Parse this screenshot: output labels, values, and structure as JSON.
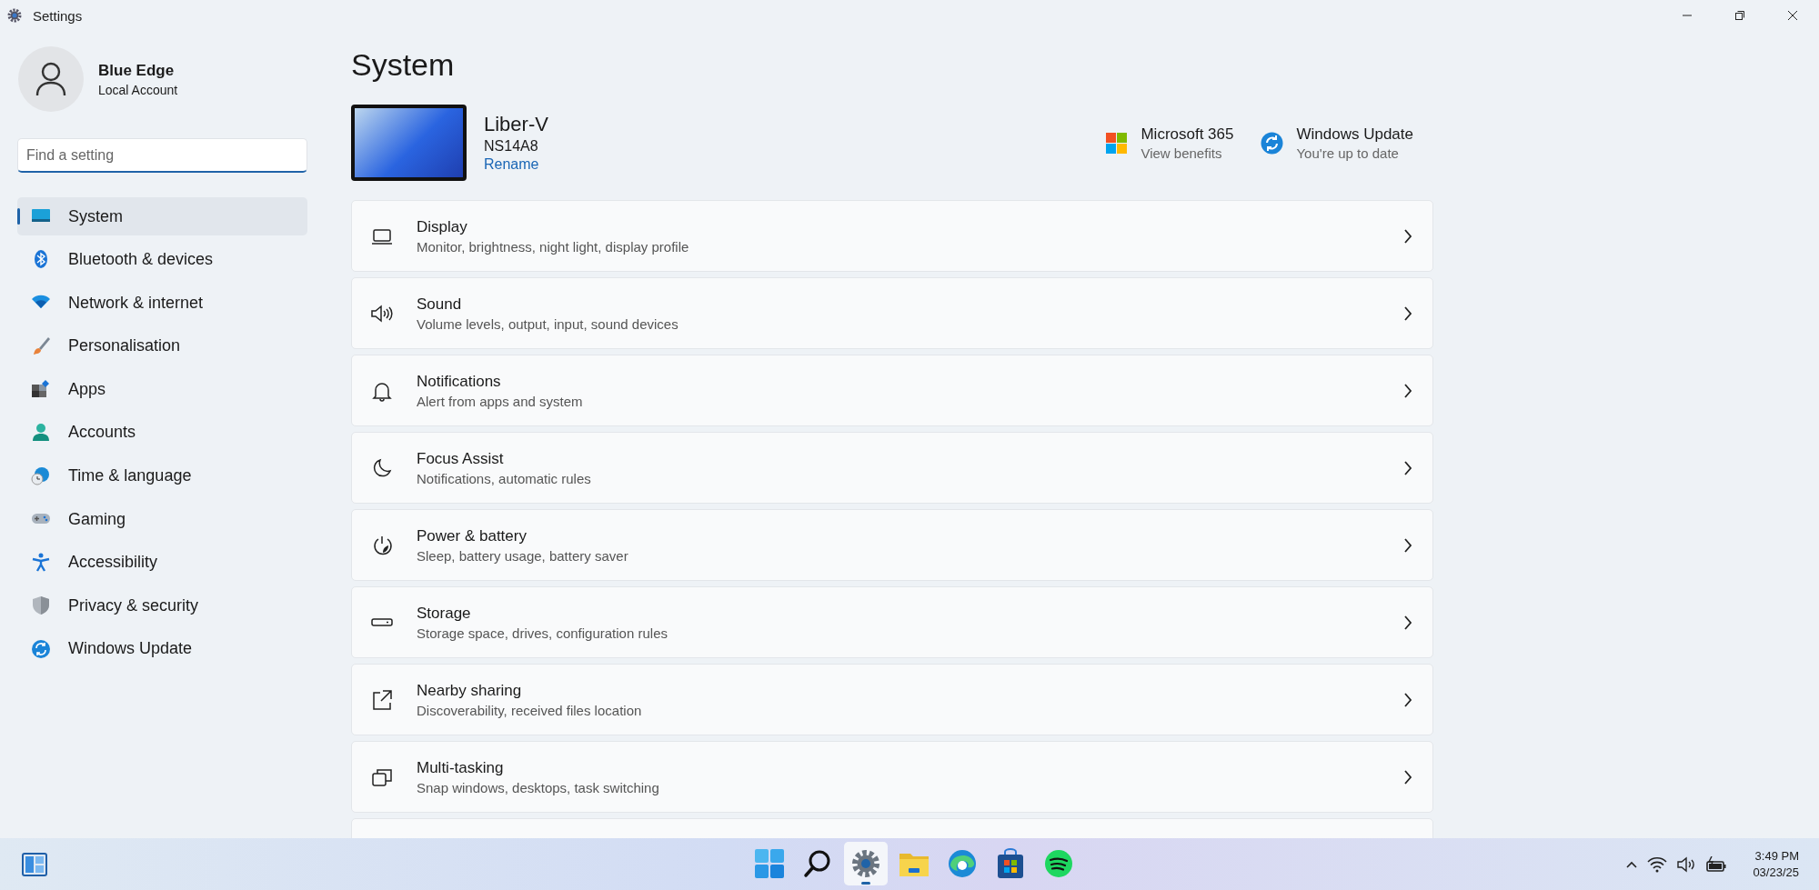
{
  "window": {
    "title": "Settings"
  },
  "account": {
    "name": "Blue Edge",
    "type": "Local Account"
  },
  "search": {
    "placeholder": "Find a setting"
  },
  "sidebar": {
    "items": [
      {
        "label": "System",
        "selected": true
      },
      {
        "label": "Bluetooth & devices",
        "selected": false
      },
      {
        "label": "Network & internet",
        "selected": false
      },
      {
        "label": "Personalisation",
        "selected": false
      },
      {
        "label": "Apps",
        "selected": false
      },
      {
        "label": "Accounts",
        "selected": false
      },
      {
        "label": "Time & language",
        "selected": false
      },
      {
        "label": "Gaming",
        "selected": false
      },
      {
        "label": "Accessibility",
        "selected": false
      },
      {
        "label": "Privacy & security",
        "selected": false
      },
      {
        "label": "Windows Update",
        "selected": false
      }
    ]
  },
  "page": {
    "title": "System"
  },
  "device": {
    "name": "Liber-V",
    "model": "NS14A8",
    "rename_link": "Rename"
  },
  "header_links": [
    {
      "title": "Microsoft 365",
      "subtitle": "View benefits"
    },
    {
      "title": "Windows Update",
      "subtitle": "You're up to date"
    }
  ],
  "settings": [
    {
      "title": "Display",
      "subtitle": "Monitor, brightness, night light, display profile"
    },
    {
      "title": "Sound",
      "subtitle": "Volume levels, output, input, sound devices"
    },
    {
      "title": "Notifications",
      "subtitle": "Alert from apps and system"
    },
    {
      "title": "Focus Assist",
      "subtitle": "Notifications, automatic rules"
    },
    {
      "title": "Power & battery",
      "subtitle": "Sleep, battery usage, battery saver"
    },
    {
      "title": "Storage",
      "subtitle": "Storage space, drives, configuration rules"
    },
    {
      "title": "Nearby sharing",
      "subtitle": "Discoverability, received files location"
    },
    {
      "title": "Multi-tasking",
      "subtitle": "Snap windows, desktops, task switching"
    }
  ],
  "taskbar": {
    "apps": [
      {
        "selected": false
      },
      {
        "selected": false
      },
      {
        "selected": true
      },
      {
        "selected": false
      },
      {
        "selected": false
      },
      {
        "selected": false
      },
      {
        "selected": false
      }
    ],
    "time": "3:49 PM",
    "date": "03/23/25"
  }
}
